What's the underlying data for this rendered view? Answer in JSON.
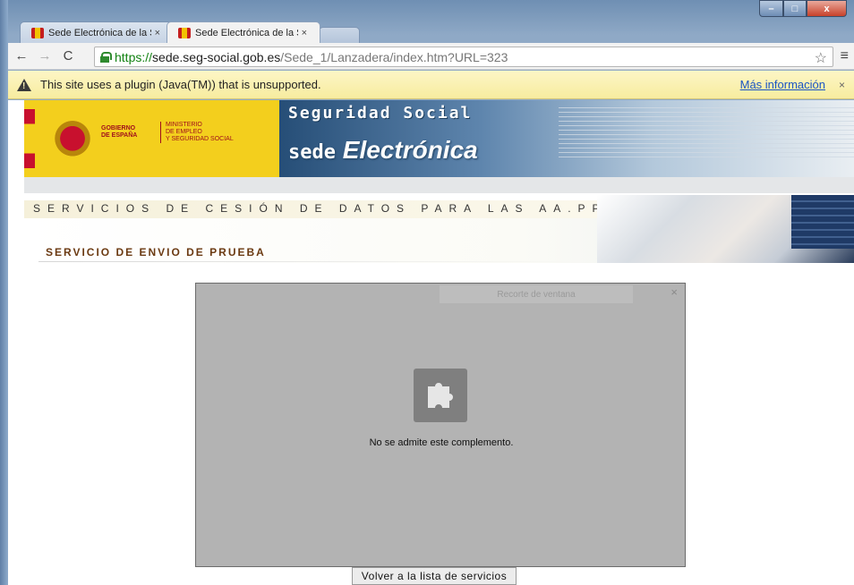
{
  "window": {
    "controls": {
      "minimize": "–",
      "maximize": "□",
      "close": "x"
    }
  },
  "tabs": [
    {
      "title": "Sede Electrónica de la Seg",
      "close": "×",
      "active": false
    },
    {
      "title": "Sede Electrónica de la Seg",
      "close": "×",
      "active": true
    }
  ],
  "toolbar": {
    "back": "←",
    "forward": "→",
    "reload": "C",
    "url": {
      "scheme": "https://",
      "host": "sede.seg-social.gob.es",
      "path": "/Sede_1/Lanzadera/index.htm?URL=323"
    },
    "star": "☆",
    "menu": "≡"
  },
  "infobar": {
    "message": "This site uses a plugin (Java(TM)) that is unsupported.",
    "link": "Más información",
    "close": "×"
  },
  "banner": {
    "gov_line1": "GOBIERNO",
    "gov_line2": "DE ESPAÑA",
    "min_line1": "MINISTERIO",
    "min_line2": "DE EMPLEO",
    "min_line3": "Y SEGURIDAD SOCIAL",
    "seg_title": "Seguridad Social",
    "sede_small": "sede",
    "sede_big": "Electrónica"
  },
  "page": {
    "services_title": "SERVICIOS DE CESIÓN DE DATOS PARA LAS AA.PP.",
    "service_name": "SERVICIO DE ENVIO DE PRUEBA"
  },
  "applet": {
    "window_label": "Recorte de ventana",
    "close": "×",
    "message": "No se admite este complemento."
  },
  "back_button": "Volver a la lista de servicios"
}
